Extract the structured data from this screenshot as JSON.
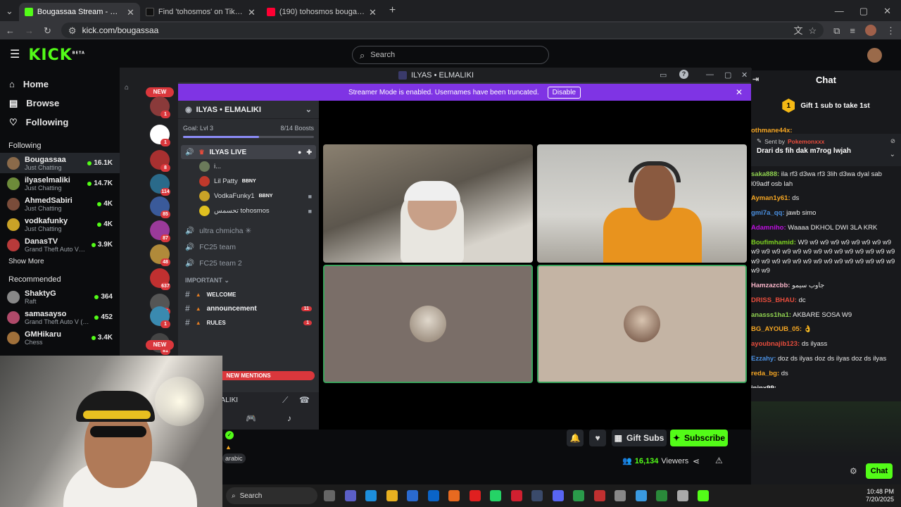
{
  "browser": {
    "tabs": [
      {
        "title": "Bougassaa Stream - Watch Live",
        "fav_color": "#53fc18",
        "active": true
      },
      {
        "title": "Find 'tohosmos' on TikTok | TikTok",
        "fav_color": "#111111",
        "active": false
      },
      {
        "title": "(190) tohosmos bougassa - YouTube",
        "fav_color": "#ff0033",
        "active": false
      }
    ],
    "url": "kick.com/bougassaa"
  },
  "kick": {
    "logo": "KICK",
    "logo_sup": "BETA",
    "search_placeholder": "Search",
    "nav": [
      {
        "label": "Home",
        "icon": "home-icon",
        "glyph": "⌂"
      },
      {
        "label": "Browse",
        "icon": "browse-icon",
        "glyph": "▤"
      },
      {
        "label": "Following",
        "icon": "heart-icon",
        "glyph": "♡"
      }
    ],
    "following_title": "Following",
    "following": [
      {
        "name": "Bougassaa",
        "category": "Just Chatting",
        "viewers": "16.1K",
        "color": "#8a6a4a",
        "selected": true
      },
      {
        "name": "ilyaselmaliki",
        "category": "Just Chatting",
        "viewers": "14.7K",
        "color": "#6d8b3a",
        "selected": false
      },
      {
        "name": "AhmedSabiri",
        "category": "Just Chatting",
        "viewers": "4K",
        "color": "#7a4c3a",
        "selected": false
      },
      {
        "name": "vodkafunky",
        "category": "Just Chatting",
        "viewers": "4K",
        "color": "#c9a227",
        "selected": false
      },
      {
        "name": "DanasTV",
        "category": "Grand Theft Auto V (...",
        "viewers": "3.9K",
        "color": "#b83a3a",
        "selected": false
      }
    ],
    "show_more": "Show More",
    "recommended_title": "Recommended",
    "recommended": [
      {
        "name": "ShaktyG",
        "category": "Raft",
        "viewers": "364",
        "color": "#888888"
      },
      {
        "name": "samasayso",
        "category": "Grand Theft Auto V (G...",
        "viewers": "452",
        "color": "#b04a6a"
      },
      {
        "name": "GMHikaru",
        "category": "Chess",
        "viewers": "3.4K",
        "color": "#a0703a"
      }
    ],
    "gift_subs": "Gift Subs",
    "subscribe": "Subscribe",
    "viewers": "16,134",
    "viewers_label": "Viewers"
  },
  "discord": {
    "window_title": "ILYAS • ELMALIKI",
    "new_label": "NEW",
    "banner_text": "Streamer Mode is enabled. Usernames have been truncated.",
    "banner_button": "Disable",
    "server_name": "ILYAS • ELMALIKI",
    "goal_label": "Goal: Lvl 3",
    "boosts": "8/14 Boosts",
    "boost_progress": 0.58,
    "active_voice": "ILYAS LIVE",
    "voice_users": [
      {
        "name": "i...",
        "tag": "",
        "color": "#6b7a5a"
      },
      {
        "name": "Lil Patty",
        "tag": "BBNY",
        "color": "#c0392b"
      },
      {
        "name": "VodkaFunky1",
        "tag": "BBNY",
        "color": "#c9a227"
      },
      {
        "name": "تحسمس tohosmos",
        "tag": "",
        "color": "#e0c020"
      }
    ],
    "voice_channels": [
      "ultra chmicha ✳",
      "FC25 team",
      "FC25 team 2"
    ],
    "category": "IMPORTANT",
    "text_channels": [
      {
        "name": "WELCOME",
        "badge": ""
      },
      {
        "name": "announcement",
        "badge": "11"
      },
      {
        "name": "RULES",
        "badge": "1"
      }
    ],
    "new_mentions": "NEW MENTIONS",
    "user_panel_name": "ELMALIKI",
    "guild_badges": [
      "1",
      "1",
      "8",
      "114",
      "85",
      "87",
      "48",
      "637",
      "16",
      "1",
      "81"
    ]
  },
  "chat": {
    "title": "Chat",
    "gift_text": "Gift 1 sub to take 1st",
    "gift_rank": "1",
    "top_user": "othmane44x:",
    "pinned_sent_by": "Sent by",
    "pinned_author": "Pokemonxxx",
    "pinned_text": "Drari ds fih dak m7rog lwjah",
    "messages": [
      {
        "user": "saka888:",
        "color": "#8fd14f",
        "text": "ila rf3 d3wa rf3 3lih d3wa dyal sab l09adf osb lah"
      },
      {
        "user": "Ayman1y61:",
        "color": "#f5a623",
        "text": "ds"
      },
      {
        "user": "gmi7a_qq:",
        "color": "#4a90e2",
        "text": "jawb simo"
      },
      {
        "user": "Adamniho:",
        "color": "#bd10e0",
        "text": "Waaaa DKHOL DWI 3LA KRK"
      },
      {
        "user": "Boufimhamid:",
        "color": "#7ed321",
        "text": "W9 w9 w9 w9 w9 w9 w9 w9 w9 w9 w9 w9 w9 w9 w9 w9 w9 w9 w9 w9 w9 w9 w9 w9 w9 w9 w9 w9 w9 w9 w9 w9 w9 w9 w9 w9 w9 w9 w9"
      },
      {
        "user": "Hamzazcbb:",
        "color": "#f8b4c8",
        "text": "جاوب سيمو"
      },
      {
        "user": "DRISS_BHAU:",
        "color": "#e74c3c",
        "text": "dc"
      },
      {
        "user": "anasss1ha1:",
        "color": "#8fd14f",
        "text": "AKBARE SOSA W9"
      },
      {
        "user": "BG_AYOUB_05:",
        "color": "#f5a623",
        "text": "👌"
      },
      {
        "user": "ayoubnajib123:",
        "color": "#e74c3c",
        "text": "ds ilyass"
      },
      {
        "user": "Ezzahy:",
        "color": "#4a90e2",
        "text": "doz ds ilyas doz ds ilyas doz ds ilyas"
      },
      {
        "user": "reda_bg:",
        "color": "#f5a623",
        "text": "ds"
      },
      {
        "user": "jninx99:",
        "color": "#ffffff",
        "text": ""
      }
    ],
    "send_button": "Chat"
  },
  "taskbar": {
    "search": "Search",
    "time": "10:48 PM",
    "date": "7/20/2025"
  }
}
